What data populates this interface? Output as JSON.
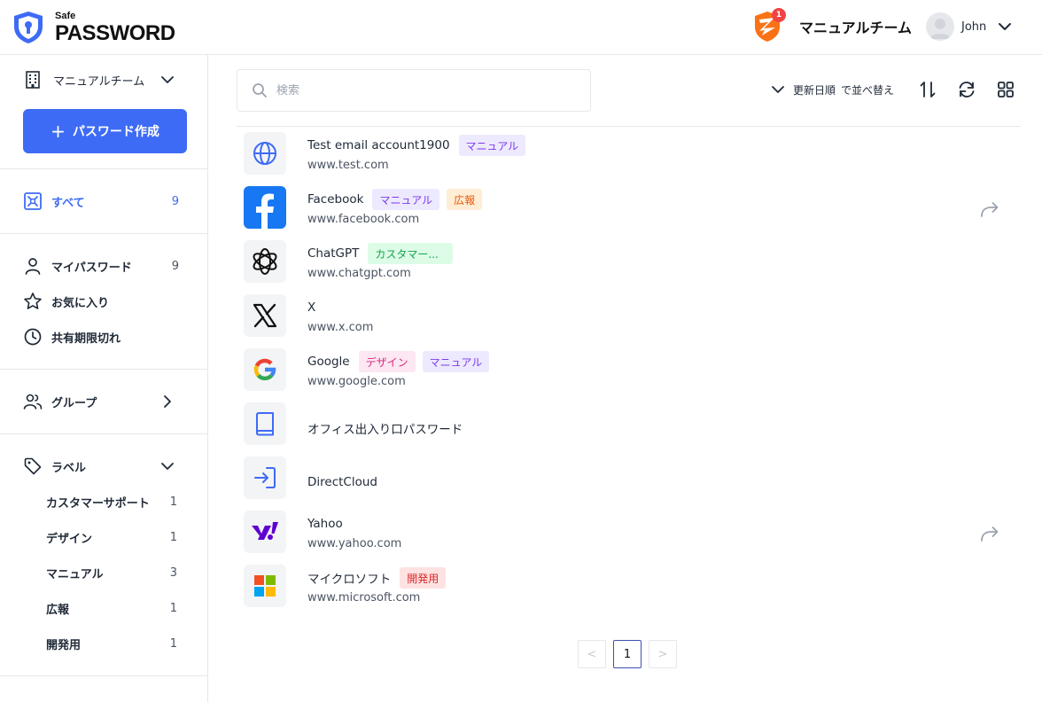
{
  "brand": {
    "safe": "Safe",
    "password": "PASSWORD"
  },
  "header": {
    "team_name": "マニュアルチーム",
    "notification_count": "1",
    "user_name": "John"
  },
  "sidebar": {
    "team_selector": "マニュアルチーム",
    "create_button": "パスワード作成",
    "all": {
      "label": "すべて",
      "count": "9"
    },
    "my_passwords": {
      "label": "マイパスワード",
      "count": "9"
    },
    "favorites": {
      "label": "お気に入り"
    },
    "expired": {
      "label": "共有期限切れ"
    },
    "groups": {
      "label": "グループ"
    },
    "labels": {
      "label": "ラベル",
      "items": [
        {
          "name": "カスタマーサポート",
          "count": "1"
        },
        {
          "name": "デザイン",
          "count": "1"
        },
        {
          "name": "マニュアル",
          "count": "3"
        },
        {
          "name": "広報",
          "count": "1"
        },
        {
          "name": "開発用",
          "count": "1"
        }
      ]
    }
  },
  "toolbar": {
    "search_placeholder": "検索",
    "sort_field": "更新日順",
    "sort_suffix": "で並べ替え"
  },
  "items": [
    {
      "title": "Test email account1900",
      "url": "www.test.com",
      "tags": [
        "マニュアル"
      ]
    },
    {
      "title": "Facebook",
      "url": "www.facebook.com",
      "tags": [
        "マニュアル",
        "広報"
      ]
    },
    {
      "title": "ChatGPT",
      "url": "www.chatgpt.com",
      "tags": [
        "カスタマー..."
      ]
    },
    {
      "title": "X",
      "url": "www.x.com",
      "tags": []
    },
    {
      "title": "Google",
      "url": "www.google.com",
      "tags": [
        "デザイン",
        "マニュアル"
      ]
    },
    {
      "title": "オフィス出入り口パスワード",
      "url": "",
      "tags": []
    },
    {
      "title": "DirectCloud",
      "url": "",
      "tags": []
    },
    {
      "title": "Yahoo",
      "url": "www.yahoo.com",
      "tags": []
    },
    {
      "title": "マイクロソフト",
      "url": "www.microsoft.com",
      "tags": [
        "開発用"
      ]
    }
  ],
  "pagination": {
    "prev": "<",
    "current": "1",
    "next": ">"
  },
  "colors": {
    "accent": "#3e6bf5",
    "text": "#1f2937",
    "muted": "#4b5563",
    "border": "#e5e7eb"
  },
  "icons": [
    "shield-logo-icon",
    "team-logo-icon",
    "avatar-icon",
    "chevron-down-icon",
    "building-icon",
    "plus-icon",
    "all-items-icon",
    "user-icon",
    "star-icon",
    "clock-icon",
    "users-icon",
    "chevron-right-icon",
    "tag-icon",
    "search-icon",
    "sort-icon",
    "refresh-icon",
    "grid-icon",
    "globe-icon",
    "facebook-icon",
    "chatgpt-icon",
    "x-icon",
    "google-icon",
    "book-icon",
    "login-icon",
    "yahoo-icon",
    "microsoft-icon",
    "share-icon"
  ]
}
